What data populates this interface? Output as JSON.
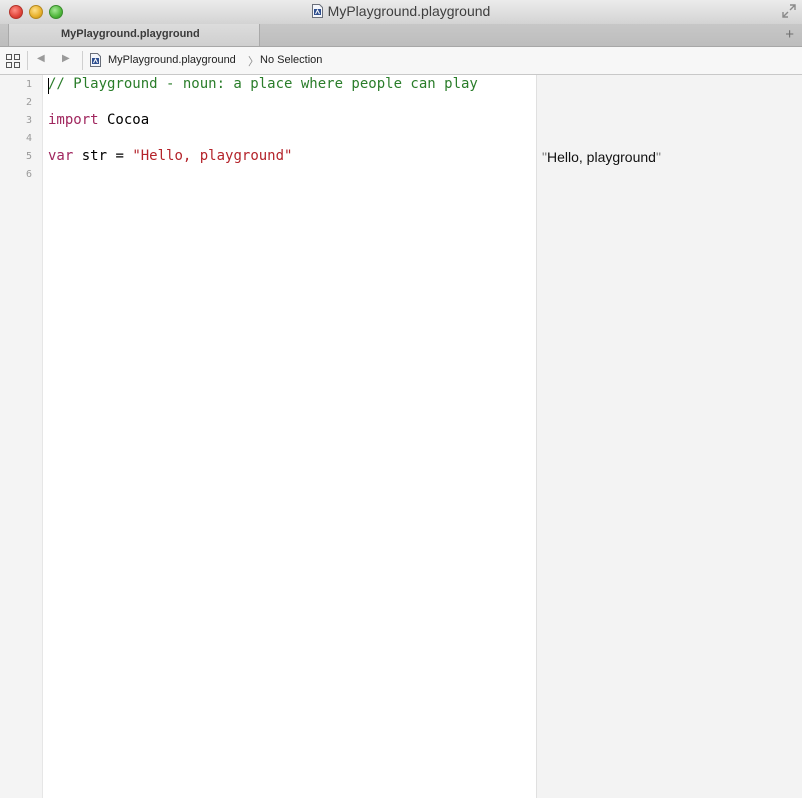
{
  "window": {
    "title": "MyPlayground.playground"
  },
  "tabbar": {
    "tab_label": "MyPlayground.playground",
    "add_tab_symbol": "+"
  },
  "jumpbar": {
    "file": "MyPlayground.playground",
    "chevron": "〉",
    "selection": "No Selection",
    "back_symbol": "◀",
    "forward_symbol": "▶"
  },
  "editor": {
    "line_numbers": [
      "1",
      "2",
      "3",
      "4",
      "5",
      "6"
    ],
    "lines": {
      "comment": "// Playground - noun: a place where people can play",
      "import_kw": "import",
      "import_module": " Cocoa",
      "var_kw": "var",
      "var_rest": " str = ",
      "var_value": "\"Hello, playground\""
    }
  },
  "results": {
    "open_quote": "\"",
    "value": "Hello, playground",
    "close_quote": "\""
  },
  "colors": {
    "comment": "#2a7d2a",
    "keyword": "#a0265e",
    "string": "#b4232a",
    "close_button": "#e0443a",
    "minimize_button": "#e7b02a",
    "zoom_button": "#50b73c"
  },
  "icons": [
    "playground-file-icon",
    "fullscreen-icon",
    "grid-icon",
    "back-arrow-icon",
    "forward-arrow-icon",
    "add-tab-icon"
  ]
}
